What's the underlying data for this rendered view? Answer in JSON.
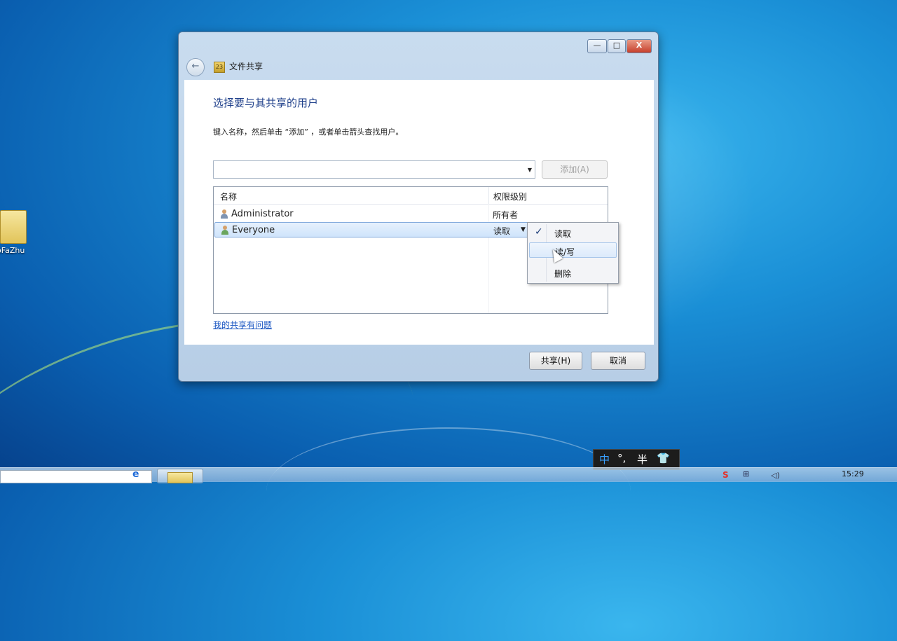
{
  "desktop": {
    "icon_label": "loFaZhu"
  },
  "window": {
    "title": "文件共享",
    "title_icon_text": "23",
    "controls": {
      "minimize": "—",
      "maximize": "□",
      "close": "X"
    },
    "heading": "选择要与其共享的用户",
    "instruction": "键入名称，然后单击 “添加” ，或者单击箭头查找用户。",
    "combo_value": "",
    "add_button": "添加(A)",
    "columns": {
      "name": "名称",
      "permission": "权限级别"
    },
    "rows": [
      {
        "name": "Administrator",
        "permission": "所有者",
        "icon": "user-icon",
        "selected": false
      },
      {
        "name": "Everyone",
        "permission": "读取",
        "icon": "group-icon",
        "selected": true
      }
    ],
    "help_link": "我的共享有问题",
    "share_button": "共享(H)",
    "cancel_button": "取消"
  },
  "permission_menu": {
    "items": [
      {
        "label": "读取",
        "checked": true
      },
      {
        "label": "读/写",
        "checked": false,
        "hovered": true
      },
      {
        "label": "删除",
        "checked": false
      }
    ]
  },
  "ime": {
    "mode": "中",
    "punct": "°,",
    "width": "半",
    "skin": "👕"
  },
  "taskbar": {
    "clock": "15:29"
  },
  "colors": {
    "heading": "#1e3f8a",
    "link": "#1a56c2",
    "selection": "#cfe4fb",
    "desktop": "#1a8fd6"
  }
}
